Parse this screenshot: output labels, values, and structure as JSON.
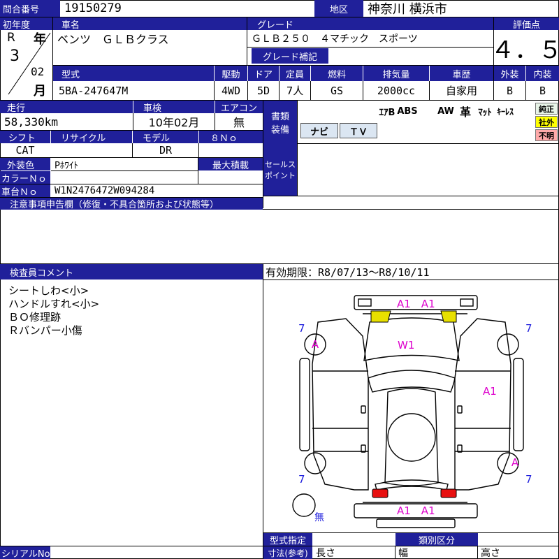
{
  "header": {
    "inquiry_label": "問合番号",
    "inquiry_no": "19150279",
    "region_label": "地区",
    "region": "神奈川 横浜市"
  },
  "registration": {
    "label": "初年度",
    "era": "R",
    "year": "3",
    "year_unit": "年",
    "month": "02",
    "month_unit": "月"
  },
  "car": {
    "name_label": "車名",
    "name": "ベンツ　ＧＬＢクラス",
    "grade_label": "グレード",
    "grade": "ＧＬＢ２５０　４マチック　スポーツ",
    "grade_supp_label": "グレード補記",
    "grade_supp": ""
  },
  "score": {
    "label": "評価点",
    "value": "４．５"
  },
  "specs": {
    "labels": {
      "model": "型式",
      "drive": "駆動",
      "doors": "ドア",
      "capacity": "定員",
      "fuel": "燃料",
      "displacement": "排気量",
      "history": "車歴",
      "exterior": "外装",
      "interior": "内装"
    },
    "model": "5BA-247647M",
    "drive": "4WD",
    "doors": "5D",
    "capacity": "7人",
    "fuel": "GS",
    "displacement": "2000cc",
    "history": "自家用",
    "exterior_grade": "B",
    "interior_grade": "B"
  },
  "usage": {
    "mileage_label": "走行",
    "mileage": "58,330km",
    "inspection_label": "車検",
    "inspection": "10年02月",
    "ac_label": "エアコン",
    "ac": "無"
  },
  "equipment": {
    "label": "書類装備",
    "label_line1": "書類",
    "label_line2": "装備",
    "items_top": [
      "ｴｱB",
      "ABS",
      "AW",
      "革",
      "ﾏｯﾄ",
      "ｷｰﾚｽ"
    ],
    "items_bottom": [
      "ナビ",
      "ＴＶ"
    ],
    "origin_tags": [
      {
        "label": "純正",
        "color": "#e8f4e8"
      },
      {
        "label": "社外",
        "color": "#ffff00"
      },
      {
        "label": "不明",
        "color": "#ffaaaa"
      }
    ]
  },
  "misc": {
    "shift_label": "シフト",
    "shift": "CAT",
    "recycle_label": "リサイクル",
    "recycle": "",
    "model_label": "モデル",
    "model_value": "DR",
    "eight_no_label": "８Ｎｏ",
    "eight_no": "",
    "color_label": "外装色",
    "color": "Pﾎﾜｲﾄ",
    "color_no_label": "カラーＮｏ",
    "color_no": "",
    "max_load_label": "最大積載",
    "max_load": "",
    "chassis_label": "車台Ｎｏ",
    "chassis": "W1N2476472W094284",
    "sales_point_label_1": "セールス",
    "sales_point_label_2": "ポイント"
  },
  "notes": {
    "label": "注意事項申告欄（修復・不具合箇所および状態等）",
    "text": ""
  },
  "inspector": {
    "label": "検査員コメント",
    "comments": [
      "シートしわ<小>",
      "ハンドルすれ<小>",
      "ＢＯ修理跡",
      "Ｒバンパー小傷"
    ]
  },
  "validity": "有効期限：R8/07/13〜R8/10/11",
  "diagram": {
    "front_bumper_marks": "A1　A1",
    "hood_mark": "W1",
    "right_side_mark": "A1",
    "rear_bumper_marks": "A1　A1",
    "wheel_a": "A",
    "tire_7": "7",
    "spare_mark": "無",
    "front_lamp_color": "#e8e000",
    "rear_lamp_color": "#e81010",
    "mark_color": "#dd00cc",
    "tire_color": "#2020dd"
  },
  "footer": {
    "type_spec_label": "型式指定",
    "type_spec": "",
    "category_label": "類別区分",
    "category": "",
    "serial_label": "シリアルNo",
    "serial": "",
    "dims_label": "寸法(参考)",
    "length_label": "長さ",
    "width_label": "幅",
    "height_label": "高さ"
  }
}
